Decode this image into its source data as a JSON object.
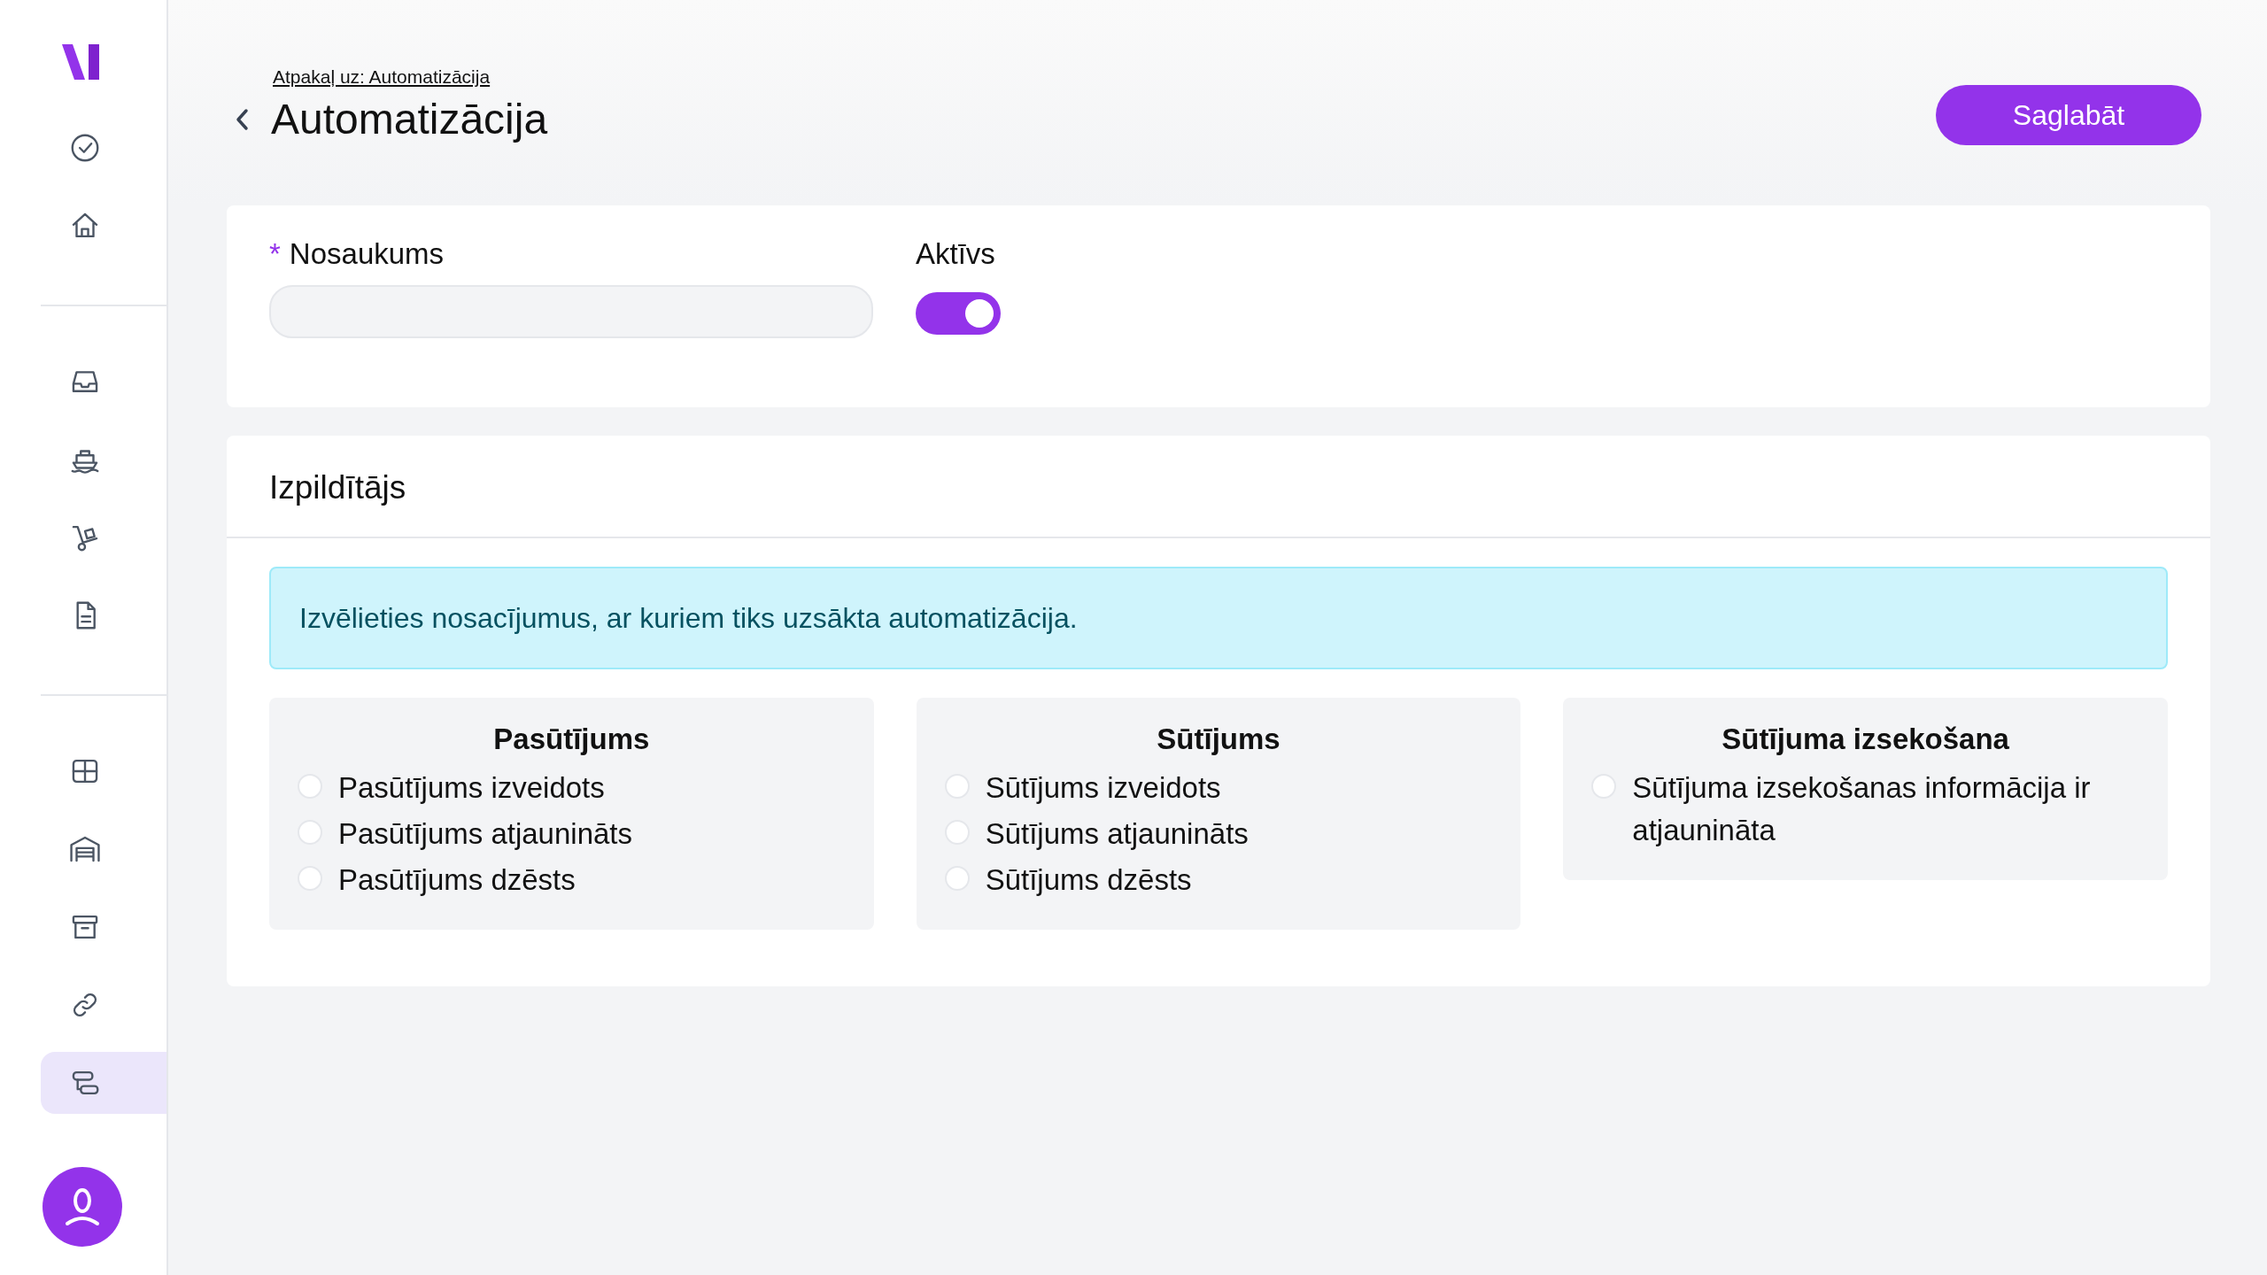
{
  "sidebar": {
    "groups": [
      [
        {
          "selected": false
        },
        {
          "selected": false
        }
      ],
      [
        {
          "selected": false
        },
        {
          "selected": false
        },
        {
          "selected": false
        },
        {
          "selected": false
        }
      ],
      [
        {
          "selected": false
        },
        {
          "selected": false
        },
        {
          "selected": false
        },
        {
          "selected": false
        },
        {
          "selected": true
        }
      ]
    ]
  },
  "header": {
    "breadcrumb": "Atpakaļ uz: Automatizācija",
    "title": "Automatizācija",
    "save_button": "Saglabāt"
  },
  "general": {
    "name_label": "Nosaukums",
    "required_mark": "*",
    "active_label": "Aktīvs",
    "active_on": true
  },
  "executor": {
    "title": "Izpildītājs",
    "info": "Izvēlieties nosacījumus, ar kuriem tiks uzsākta automatizācija.",
    "groups": [
      {
        "title": "Pasūtījums",
        "options": [
          {
            "label": "Pasūtījums izveidots",
            "checked": false
          },
          {
            "label": "Pasūtījums atjaunināts",
            "checked": false
          },
          {
            "label": "Pasūtījums dzēsts",
            "checked": false
          }
        ]
      },
      {
        "title": "Sūtījums",
        "options": [
          {
            "label": "Sūtījums izveidots",
            "checked": false
          },
          {
            "label": "Sūtījums atjaunināts",
            "checked": false
          },
          {
            "label": "Sūtījums dzēsts",
            "checked": false
          }
        ]
      },
      {
        "title": "Sūtījuma izsekošana",
        "options": [
          {
            "label": "Sūtījuma izsekošanas informācija ir atjaunināta",
            "checked": false
          }
        ]
      }
    ]
  }
}
